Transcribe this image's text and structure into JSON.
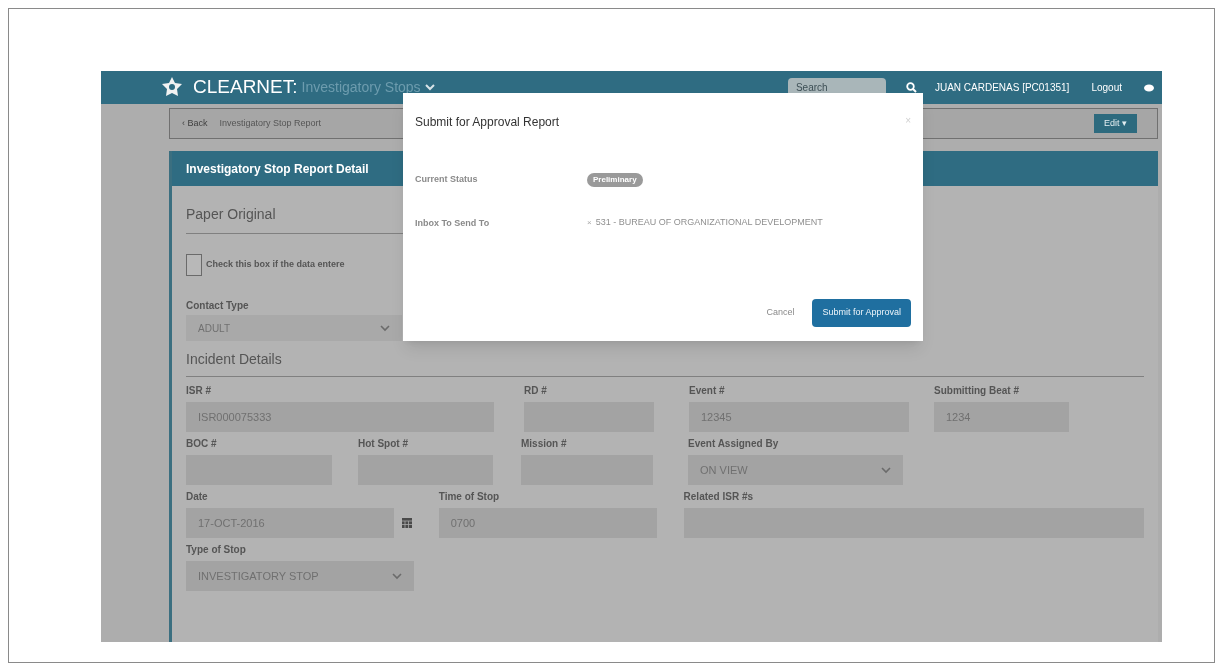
{
  "header": {
    "brand": "CLEARNET:",
    "module": "Investigatory Stops",
    "search": {
      "placeholder": "Search"
    },
    "user": "JUAN CARDENAS [PC01351]",
    "logout": "Logout"
  },
  "breadcrumb": {
    "back": "‹ Back",
    "current": "Investigatory Stop Report",
    "edit": "Edit",
    "edit_caret": "▾"
  },
  "panel": {
    "title": "Investigatory Stop Report Detail",
    "paper_original": {
      "heading": "Paper Original",
      "checkbox": {
        "label": "Check this box if the data entere",
        "checked": false
      }
    },
    "contact_type": {
      "label": "Contact Type",
      "value": "ADULT"
    },
    "incident": {
      "heading": "Incident Details",
      "fields": [
        {
          "label": "ISR #",
          "value": "ISR000075333",
          "kind": "text"
        },
        {
          "label": "RD #",
          "kind": "text"
        },
        {
          "label": "Event #",
          "value": "12345",
          "kind": "text"
        },
        {
          "label": "Submitting Beat #",
          "value": "1234",
          "kind": "text"
        },
        {
          "label": "BOC #",
          "kind": "text"
        },
        {
          "label": "Hot Spot #",
          "kind": "text"
        },
        {
          "label": "Mission #",
          "kind": "text"
        },
        {
          "label": "Event Assigned By",
          "value": "ON VIEW",
          "kind": "select"
        },
        {
          "label": "Date",
          "value": "17-OCT-2016",
          "kind": "date"
        },
        {
          "label": "Time of Stop",
          "value": "0700",
          "kind": "text"
        },
        {
          "label": "Related ISR #s",
          "kind": "text"
        },
        {
          "label": "Type of Stop",
          "value": "INVESTIGATORY STOP",
          "kind": "select"
        }
      ]
    }
  },
  "modal": {
    "title": "Submit for Approval Report",
    "close": "×",
    "status_label": "Current Status",
    "status": "Preliminary",
    "inbox_label": "Inbox To Send To",
    "inbox": {
      "remove": "×",
      "value": "531 - BUREAU OF ORGANIZATIONAL DEVELOPMENT"
    },
    "cancel": "Cancel",
    "submit": "Submit for Approval"
  }
}
